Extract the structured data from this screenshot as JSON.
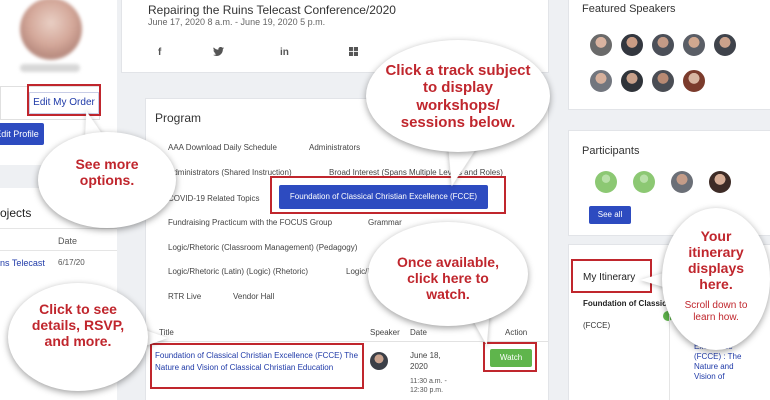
{
  "event": {
    "title": "Repairing the Ruins Telecast Conference/2020",
    "dates": "June 17, 2020 8 a.m. - June 19, 2020 5 p.m.",
    "share": [
      "f",
      "t",
      "in",
      "win"
    ]
  },
  "left": {
    "edit_order_label": "Edit My Order",
    "edit_profile_label": "Edit Profile",
    "projects_title": "ojects",
    "date_header": "Date",
    "project_name": "ns Telecast",
    "project_date": "6/17/20"
  },
  "program": {
    "title": "Program",
    "tracks": {
      "t1": "AAA Download Daily Schedule",
      "t2": "Administrators",
      "t3": "Administrators (Shared Instruction)",
      "t4": "Broad Interest (Spans Multiple Levels and Roles)",
      "t5": "COVID-19 Related Topics",
      "t6": "Foundation of Classical Christian Excellence (FCCE)",
      "t7": "Fundraising Practicum with the FOCUS Group",
      "t8": "Grammar",
      "t9": "Logic/Rhetoric (Classroom Management) (Pedagogy)",
      "t10": "Logic/Rhetoric (Latin) (Logic) (Rhetoric)",
      "t11": "Logic/R",
      "t12": "RTR Live",
      "t13": "Vendor Hall"
    },
    "table": {
      "col_title": "Title",
      "col_speaker": "Speaker",
      "col_date": "Date",
      "col_action": "Action"
    },
    "session": {
      "title": "Foundation of Classical Christian Excellence (FCCE) The Nature and Vision of Classical Christian Education",
      "date": "June 18, 2020",
      "time": "11:30 a.m. - 12:30 p.m.",
      "watch_label": "Watch"
    }
  },
  "sidebar": {
    "featured_title": "Featured Speakers",
    "participants_title": "Participants",
    "see_all_label": "See all",
    "itinerary_title": "My Itinerary",
    "itinerary_item": "Foundation of Classica",
    "itinerary_item2": "(FCCE)",
    "itinerary_link": "Excellence (FCCE) : The Nature and Vision of"
  },
  "callouts": {
    "track": "Click a track subject to display workshops/ sessions below.",
    "options": "See more options.",
    "watch": "Once available, click here to watch.",
    "details": "Click to see details, RSVP, and more.",
    "itinerary": "Your itinerary displays here.",
    "itinerary_sub": "Scroll down to learn how."
  },
  "colors": {
    "primary": "#2d4bc0",
    "watch": "#5fb54c",
    "highlight": "#c0262d",
    "link": "#1f3aa8"
  }
}
